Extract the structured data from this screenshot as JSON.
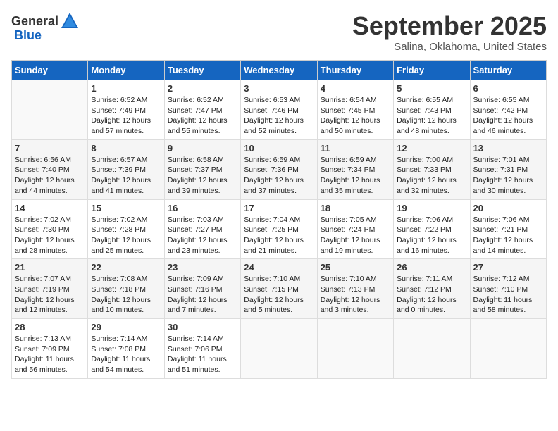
{
  "header": {
    "logo_general": "General",
    "logo_blue": "Blue",
    "month": "September 2025",
    "location": "Salina, Oklahoma, United States"
  },
  "days_of_week": [
    "Sunday",
    "Monday",
    "Tuesday",
    "Wednesday",
    "Thursday",
    "Friday",
    "Saturday"
  ],
  "weeks": [
    [
      {
        "day": "",
        "info": ""
      },
      {
        "day": "1",
        "info": "Sunrise: 6:52 AM\nSunset: 7:49 PM\nDaylight: 12 hours\nand 57 minutes."
      },
      {
        "day": "2",
        "info": "Sunrise: 6:52 AM\nSunset: 7:47 PM\nDaylight: 12 hours\nand 55 minutes."
      },
      {
        "day": "3",
        "info": "Sunrise: 6:53 AM\nSunset: 7:46 PM\nDaylight: 12 hours\nand 52 minutes."
      },
      {
        "day": "4",
        "info": "Sunrise: 6:54 AM\nSunset: 7:45 PM\nDaylight: 12 hours\nand 50 minutes."
      },
      {
        "day": "5",
        "info": "Sunrise: 6:55 AM\nSunset: 7:43 PM\nDaylight: 12 hours\nand 48 minutes."
      },
      {
        "day": "6",
        "info": "Sunrise: 6:55 AM\nSunset: 7:42 PM\nDaylight: 12 hours\nand 46 minutes."
      }
    ],
    [
      {
        "day": "7",
        "info": "Sunrise: 6:56 AM\nSunset: 7:40 PM\nDaylight: 12 hours\nand 44 minutes."
      },
      {
        "day": "8",
        "info": "Sunrise: 6:57 AM\nSunset: 7:39 PM\nDaylight: 12 hours\nand 41 minutes."
      },
      {
        "day": "9",
        "info": "Sunrise: 6:58 AM\nSunset: 7:37 PM\nDaylight: 12 hours\nand 39 minutes."
      },
      {
        "day": "10",
        "info": "Sunrise: 6:59 AM\nSunset: 7:36 PM\nDaylight: 12 hours\nand 37 minutes."
      },
      {
        "day": "11",
        "info": "Sunrise: 6:59 AM\nSunset: 7:34 PM\nDaylight: 12 hours\nand 35 minutes."
      },
      {
        "day": "12",
        "info": "Sunrise: 7:00 AM\nSunset: 7:33 PM\nDaylight: 12 hours\nand 32 minutes."
      },
      {
        "day": "13",
        "info": "Sunrise: 7:01 AM\nSunset: 7:31 PM\nDaylight: 12 hours\nand 30 minutes."
      }
    ],
    [
      {
        "day": "14",
        "info": "Sunrise: 7:02 AM\nSunset: 7:30 PM\nDaylight: 12 hours\nand 28 minutes."
      },
      {
        "day": "15",
        "info": "Sunrise: 7:02 AM\nSunset: 7:28 PM\nDaylight: 12 hours\nand 25 minutes."
      },
      {
        "day": "16",
        "info": "Sunrise: 7:03 AM\nSunset: 7:27 PM\nDaylight: 12 hours\nand 23 minutes."
      },
      {
        "day": "17",
        "info": "Sunrise: 7:04 AM\nSunset: 7:25 PM\nDaylight: 12 hours\nand 21 minutes."
      },
      {
        "day": "18",
        "info": "Sunrise: 7:05 AM\nSunset: 7:24 PM\nDaylight: 12 hours\nand 19 minutes."
      },
      {
        "day": "19",
        "info": "Sunrise: 7:06 AM\nSunset: 7:22 PM\nDaylight: 12 hours\nand 16 minutes."
      },
      {
        "day": "20",
        "info": "Sunrise: 7:06 AM\nSunset: 7:21 PM\nDaylight: 12 hours\nand 14 minutes."
      }
    ],
    [
      {
        "day": "21",
        "info": "Sunrise: 7:07 AM\nSunset: 7:19 PM\nDaylight: 12 hours\nand 12 minutes."
      },
      {
        "day": "22",
        "info": "Sunrise: 7:08 AM\nSunset: 7:18 PM\nDaylight: 12 hours\nand 10 minutes."
      },
      {
        "day": "23",
        "info": "Sunrise: 7:09 AM\nSunset: 7:16 PM\nDaylight: 12 hours\nand 7 minutes."
      },
      {
        "day": "24",
        "info": "Sunrise: 7:10 AM\nSunset: 7:15 PM\nDaylight: 12 hours\nand 5 minutes."
      },
      {
        "day": "25",
        "info": "Sunrise: 7:10 AM\nSunset: 7:13 PM\nDaylight: 12 hours\nand 3 minutes."
      },
      {
        "day": "26",
        "info": "Sunrise: 7:11 AM\nSunset: 7:12 PM\nDaylight: 12 hours\nand 0 minutes."
      },
      {
        "day": "27",
        "info": "Sunrise: 7:12 AM\nSunset: 7:10 PM\nDaylight: 11 hours\nand 58 minutes."
      }
    ],
    [
      {
        "day": "28",
        "info": "Sunrise: 7:13 AM\nSunset: 7:09 PM\nDaylight: 11 hours\nand 56 minutes."
      },
      {
        "day": "29",
        "info": "Sunrise: 7:14 AM\nSunset: 7:08 PM\nDaylight: 11 hours\nand 54 minutes."
      },
      {
        "day": "30",
        "info": "Sunrise: 7:14 AM\nSunset: 7:06 PM\nDaylight: 11 hours\nand 51 minutes."
      },
      {
        "day": "",
        "info": ""
      },
      {
        "day": "",
        "info": ""
      },
      {
        "day": "",
        "info": ""
      },
      {
        "day": "",
        "info": ""
      }
    ]
  ]
}
